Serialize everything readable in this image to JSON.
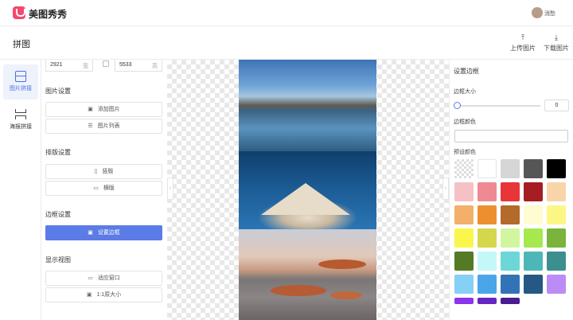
{
  "app": {
    "brand": "美图秀秀",
    "username": "消愁"
  },
  "header": {
    "page_title": "拼图",
    "upload_label": "上传图片",
    "download_label": "下载图片"
  },
  "nav": [
    {
      "label": "图片拼接",
      "active": true
    },
    {
      "label": "海报拼接",
      "active": false
    }
  ],
  "panel": {
    "width_value": "2921",
    "width_unit": "宽",
    "height_value": "5533",
    "height_unit": "高",
    "image_settings_title": "图片设置",
    "add_image_label": "添加图片",
    "image_list_label": "图片列表",
    "layout_title": "排版设置",
    "vertical_label": "竖版",
    "horizontal_label": "横版",
    "border_title": "边框设置",
    "set_border_label": "设置边框",
    "view_title": "显示视图",
    "fit_window_label": "适应窗口",
    "actual_size_label": "1:1原大小"
  },
  "right_panel": {
    "title": "设置边框",
    "border_size_label": "边框大小",
    "border_size_value": "0",
    "border_color_label": "边框颜色",
    "preset_colors_label": "预设颜色",
    "preset_colors": [
      "transparent",
      "#ffffff",
      "#d6d6d6",
      "#565656",
      "#000000",
      "#f5c1c5",
      "#ee8a93",
      "#e8353a",
      "#a41e22",
      "#f7d5a9",
      "#f2b06a",
      "#ee8f2f",
      "#b46a2b",
      "#fefcd0",
      "#fcf685",
      "#fbf64c",
      "#d4d64b",
      "#d2f5a0",
      "#a6e94f",
      "#7ab43a",
      "#557a25",
      "#c4f7f7",
      "#6cd7d8",
      "#4db7b7",
      "#3d8f8f",
      "#86cff6",
      "#4ba5e9",
      "#3273b7",
      "#265885",
      "#bb8cf5",
      "#8a34ee",
      "#6526c4",
      "#4a1c8f"
    ]
  }
}
